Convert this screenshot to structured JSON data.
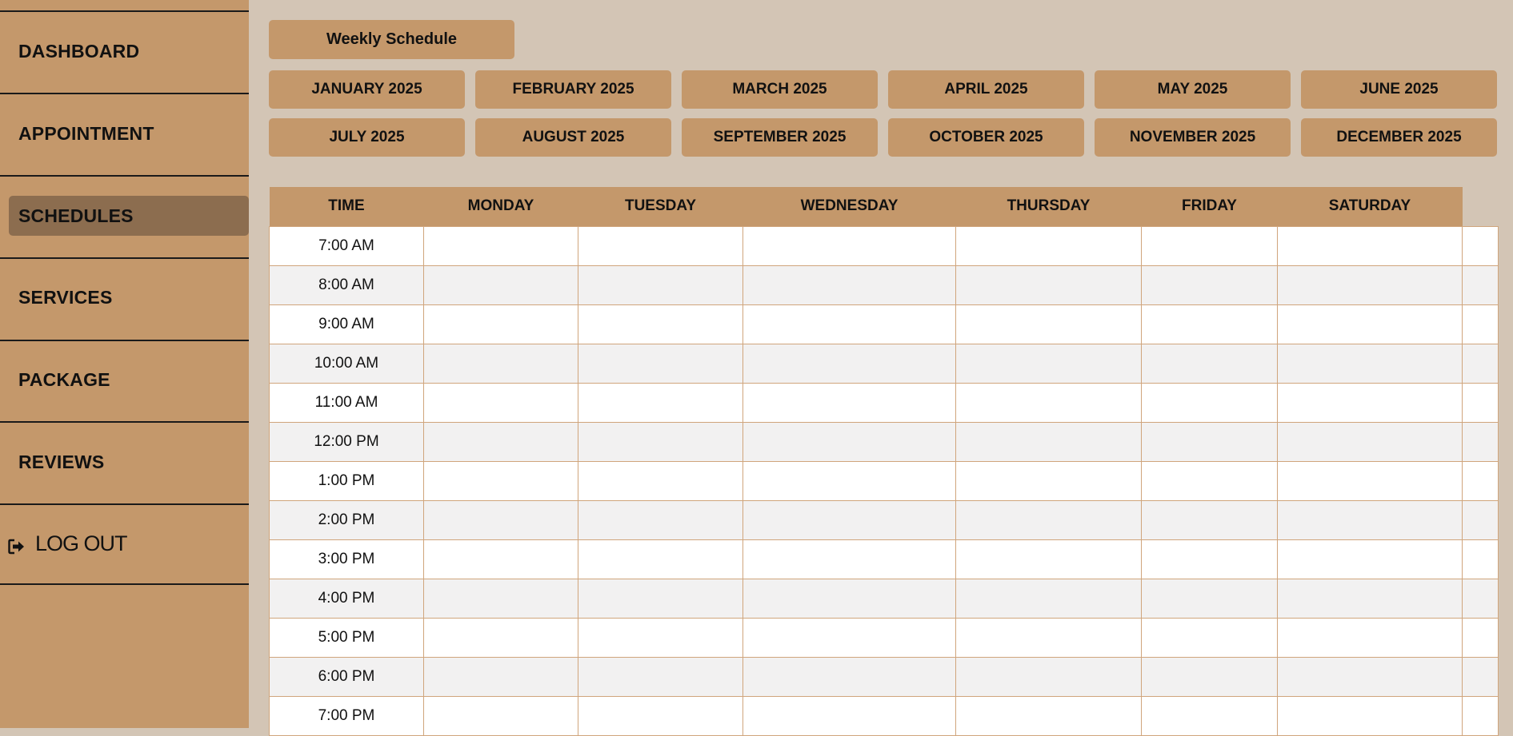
{
  "sidebar": {
    "items": [
      {
        "label": "DASHBOARD"
      },
      {
        "label": "APPOINTMENT"
      },
      {
        "label": "SCHEDULES"
      },
      {
        "label": "SERVICES"
      },
      {
        "label": "PACKAGE"
      },
      {
        "label": "REVIEWS"
      }
    ],
    "active": "SCHEDULES",
    "logout": {
      "label": "LOG OUT",
      "icon": "sign-out-icon"
    }
  },
  "schedule_nav": {
    "weekly_label": "Weekly Schedule",
    "months": [
      "JANUARY 2025",
      "FEBRUARY 2025",
      "MARCH 2025",
      "APRIL 2025",
      "MAY 2025",
      "JUNE 2025",
      "JULY 2025",
      "AUGUST 2025",
      "SEPTEMBER 2025",
      "OCTOBER 2025",
      "NOVEMBER 2025",
      "DECEMBER 2025"
    ]
  },
  "table": {
    "headers": [
      "TIME",
      "MONDAY",
      "TUESDAY",
      "WEDNESDAY",
      "THURSDAY",
      "FRIDAY",
      "SATURDAY"
    ],
    "times": [
      "7:00 AM",
      "8:00 AM",
      "9:00 AM",
      "10:00 AM",
      "11:00 AM",
      "12:00 PM",
      "1:00 PM",
      "2:00 PM",
      "3:00 PM",
      "4:00 PM",
      "5:00 PM",
      "6:00 PM",
      "7:00 PM"
    ]
  },
  "colors": {
    "sidebar_bg": "#c4986b",
    "sidebar_active": "#8c6d4f",
    "page_bg": "#d3c5b5",
    "button_bg": "#c4986b",
    "grid_line": "#d0a57c",
    "row_alt": "#f2f1f1"
  }
}
